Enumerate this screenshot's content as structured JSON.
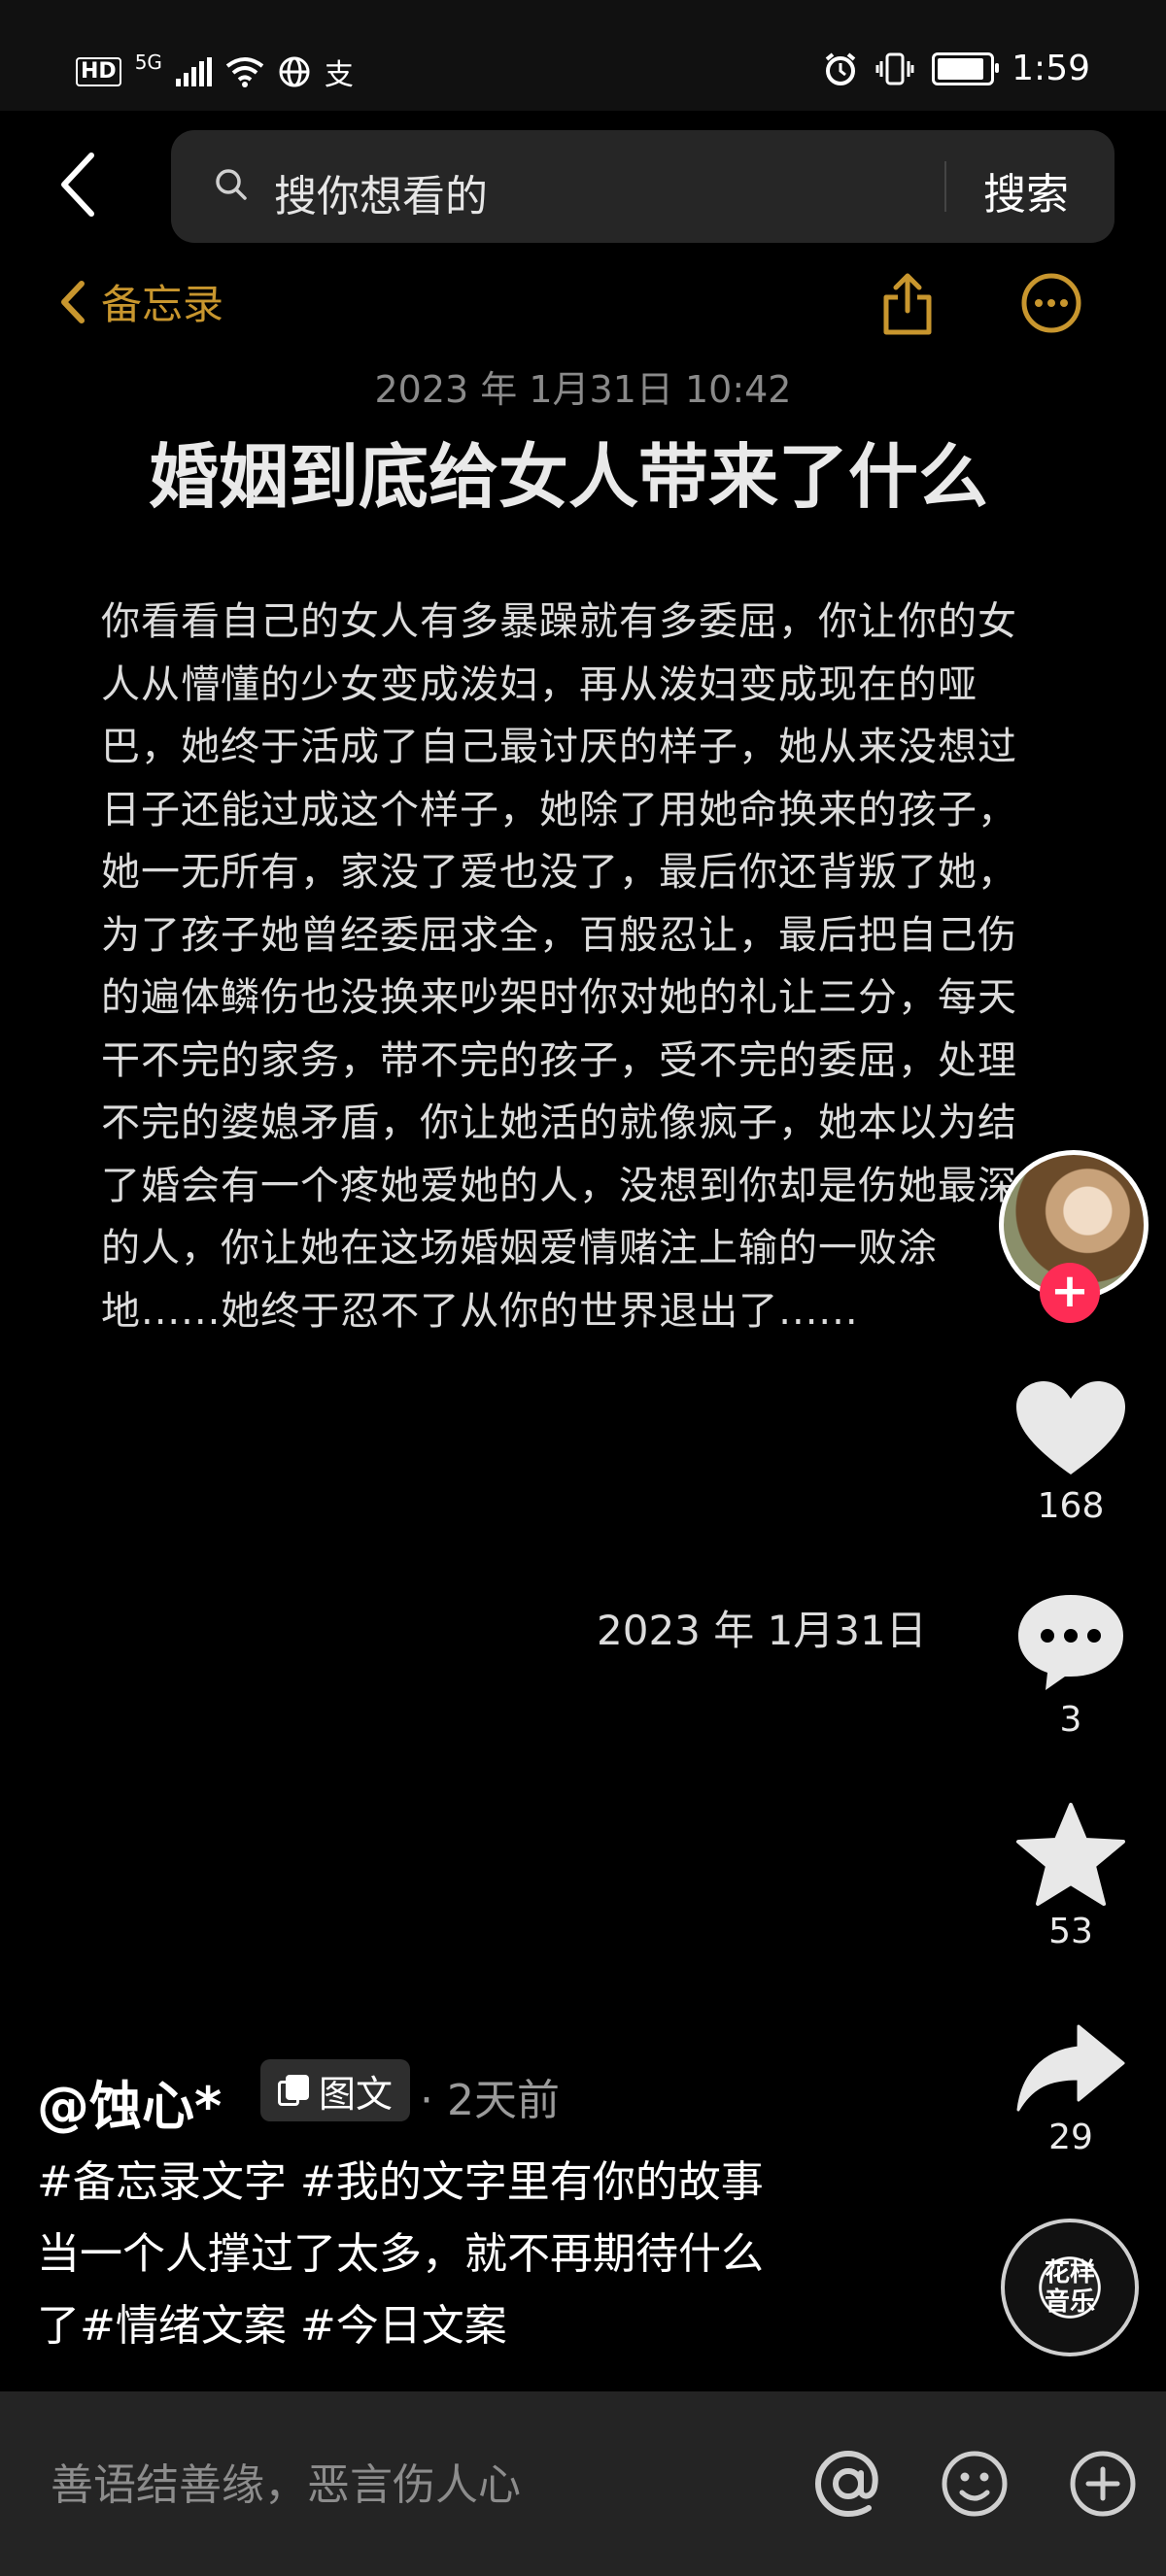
{
  "status_bar": {
    "hd": "HD",
    "network": "5G",
    "time": "1:59"
  },
  "search": {
    "placeholder": "搜你想看的",
    "button": "搜索"
  },
  "memo": {
    "back_label": "备忘录",
    "date": "2023 年 1月31日 10:42",
    "title": "婚姻到底给女人带来了什么",
    "body": "你看看自己的女人有多暴躁就有多委屈，你让你的女人从懵懂的少女变成泼妇，再从泼妇变成现在的哑巴，她终于活成了自己最讨厌的样子，她从来没想过日子还能过成这个样子，她除了用她命换来的孩子，她一无所有，家没了爱也没了，最后你还背叛了她，为了孩子她曾经委屈求全，百般忍让，最后把自己伤的遍体鳞伤也没换来吵架时你对她的礼让三分，每天干不完的家务，带不完的孩子，受不完的委屈，处理不完的婆媳矛盾，你让她活的就像疯子，她本以为结了婚会有一个疼她爱她的人，没想到你却是伤她最深的人，你让她在这场婚姻爱情赌注上输的一败涂地......她终于忍不了从你的世界退出了......",
    "signature_date": "2023 年 1月31日"
  },
  "actions": {
    "likes": "168",
    "comments": "3",
    "favorites": "53",
    "shares": "29",
    "music_label": "花样音乐"
  },
  "post": {
    "author": "@蚀心*",
    "type_badge": "图文",
    "time": "· 2天前",
    "description_line1": "#备忘录文字 #我的文字里有你的故事",
    "description_line2": "当一个人撑过了太多，就不再期待什么",
    "description_line3": "了#情绪文案 #今日文案"
  },
  "comment_bar": {
    "placeholder": "善语结善缘，恶言伤人心"
  },
  "colors": {
    "accent_gold": "#c8962e",
    "follow_red": "#fe2c55"
  }
}
